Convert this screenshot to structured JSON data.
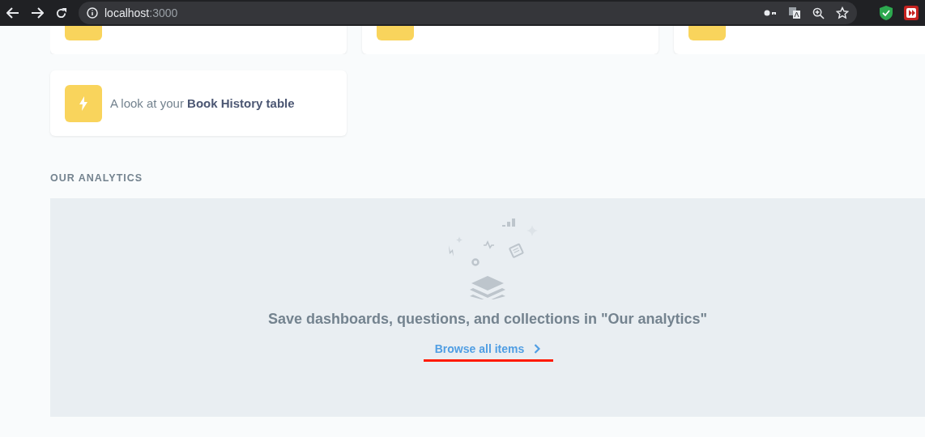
{
  "browser": {
    "host": "localhost",
    "port": ":3000"
  },
  "cards": [
    {
      "kind": "cut"
    },
    {
      "kind": "cut"
    },
    {
      "kind": "cut"
    },
    {
      "kind": "full",
      "text": "A look at your **Book History table**"
    }
  ],
  "section": {
    "title": "OUR ANALYTICS",
    "empty_message": "Save dashboards, questions, and collections in \"Our analytics\"",
    "link": "Browse all items"
  }
}
